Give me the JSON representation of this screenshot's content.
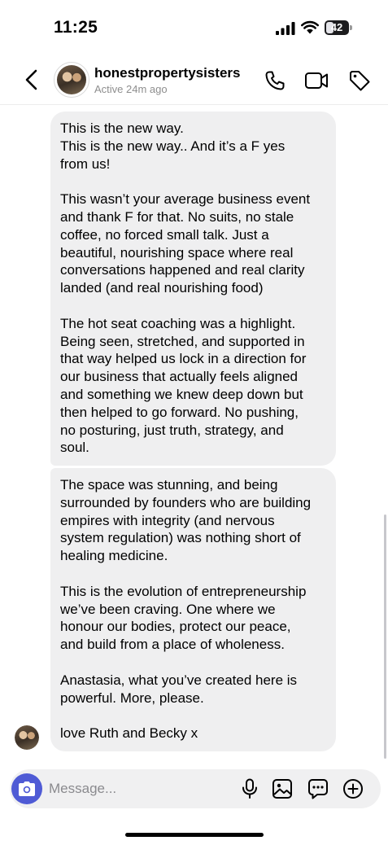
{
  "status_bar": {
    "time": "11:25",
    "battery": "42",
    "icons": [
      "signal-icon",
      "wifi-icon",
      "battery-icon"
    ]
  },
  "header": {
    "name": "honestpropertysisters",
    "status": "Active 24m ago",
    "icons": [
      "back-icon",
      "phone-icon",
      "video-icon",
      "tag-icon"
    ]
  },
  "messages": [
    {
      "text": "This is the new way.\nThis is the new way.. And it’s a F yes\nfrom us!\n\nThis wasn’t your average business event\nand thank F for that. No suits, no stale\ncoffee, no forced small talk. Just a\nbeautiful, nourishing space where real\nconversations happened and real clarity\nlanded (and real nourishing food)\n\nThe hot seat coaching was a highlight.\nBeing seen, stretched, and supported in\nthat way helped us lock in a direction for\nour business that actually feels aligned\nand something we knew deep down but\nthen helped to go forward. No pushing,\nno posturing, just truth, strategy, and\nsoul."
    },
    {
      "text": "The space was stunning, and being\nsurrounded by founders who are building\nempires with integrity (and nervous\nsystem regulation) was nothing short of\nhealing medicine.\n\nThis is the evolution of entrepreneurship\nwe’ve been craving. One where we\nhonour our bodies, protect our peace,\nand build from a place of wholeness.\n\nAnastasia, what you’ve created here is\npowerful. More, please.\n\nlove Ruth and Becky x"
    }
  ],
  "composer": {
    "placeholder": "Message...",
    "icons": [
      "camera-icon",
      "mic-icon",
      "gallery-icon",
      "sticker-icon",
      "plus-icon"
    ]
  },
  "colors": {
    "bubble": "#efeff0",
    "camera_button": "#4f5bd5",
    "secondary_text": "#8e8e8e"
  }
}
